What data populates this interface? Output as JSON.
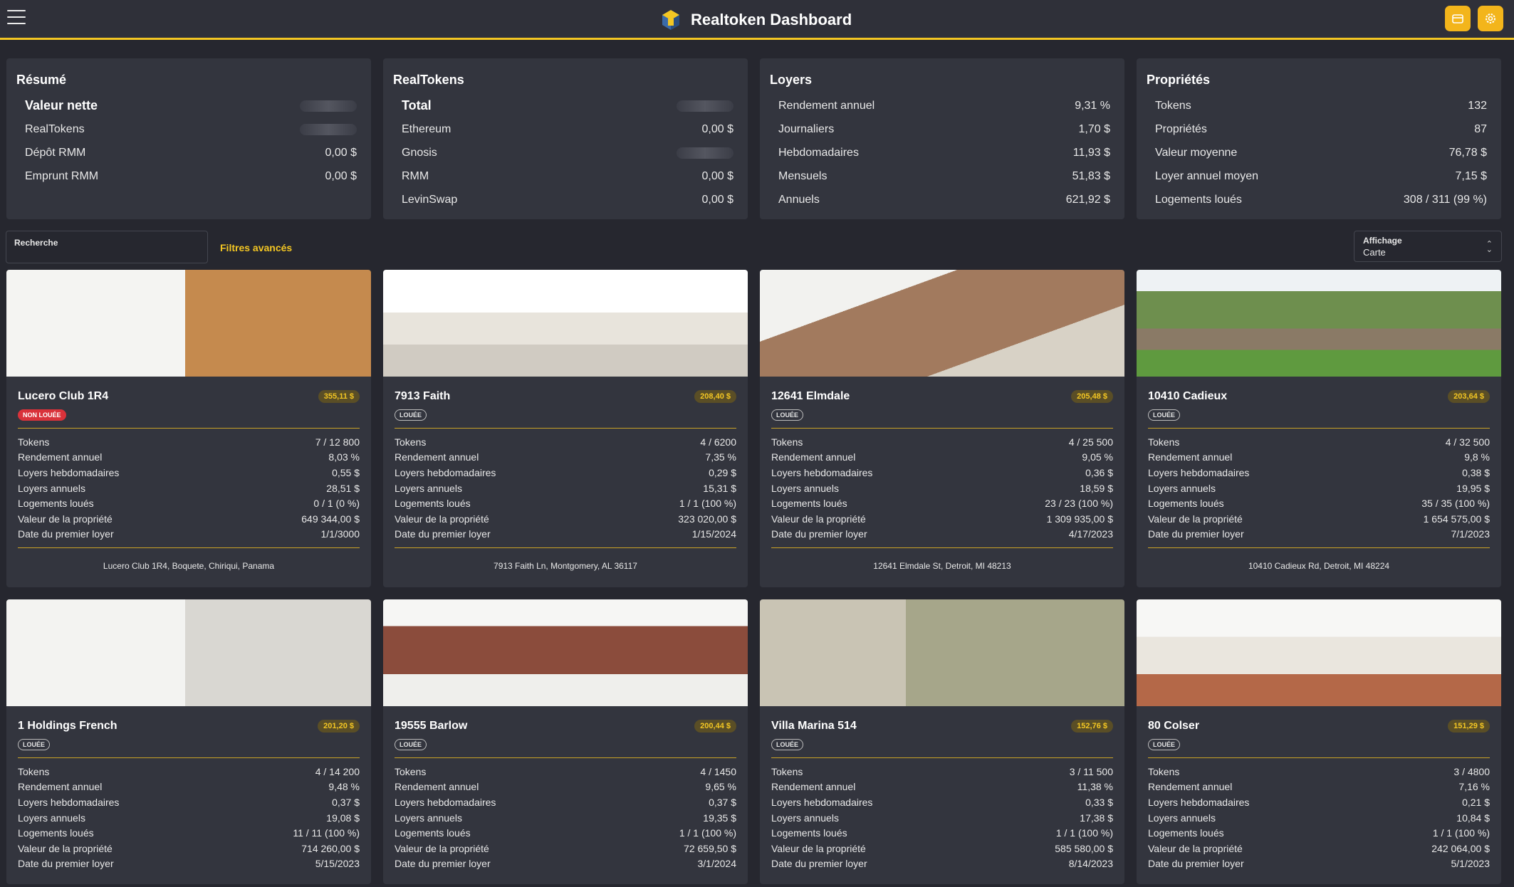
{
  "header": {
    "title": "Realtoken Dashboard",
    "menu_icon": "menu-icon",
    "wallet_icon": "wallet-icon",
    "settings_icon": "gear-icon"
  },
  "summary_cards": [
    {
      "title": "Résumé",
      "rows": [
        {
          "label": "Valeur nette",
          "value": "",
          "blurred": true
        },
        {
          "label": "RealTokens",
          "value": "",
          "blurred": true
        },
        {
          "label": "Dépôt RMM",
          "value": "0,00 $"
        },
        {
          "label": "Emprunt RMM",
          "value": "0,00 $"
        }
      ]
    },
    {
      "title": "RealTokens",
      "rows": [
        {
          "label": "Total",
          "value": "",
          "blurred": true
        },
        {
          "label": "Ethereum",
          "value": "0,00 $"
        },
        {
          "label": "Gnosis",
          "value": "",
          "blurred": true
        },
        {
          "label": "RMM",
          "value": "0,00 $"
        },
        {
          "label": "LevinSwap",
          "value": "0,00 $"
        }
      ]
    },
    {
      "title": "Loyers",
      "rows": [
        {
          "label": "Rendement annuel",
          "value": "9,31 %"
        },
        {
          "label": "Journaliers",
          "value": "1,70 $"
        },
        {
          "label": "Hebdomadaires",
          "value": "11,93 $"
        },
        {
          "label": "Mensuels",
          "value": "51,83 $"
        },
        {
          "label": "Annuels",
          "value": "621,92 $"
        }
      ]
    },
    {
      "title": "Propriétés",
      "rows": [
        {
          "label": "Tokens",
          "value": "132"
        },
        {
          "label": "Propriétés",
          "value": "87"
        },
        {
          "label": "Valeur moyenne",
          "value": "76,78 $"
        },
        {
          "label": "Loyer annuel moyen",
          "value": "7,15 $"
        },
        {
          "label": "Logements loués",
          "value": "308 / 311 (99 %)"
        }
      ]
    }
  ],
  "search": {
    "label": "Recherche"
  },
  "filters": {
    "label": "Filtres avancés"
  },
  "display": {
    "label": "Affichage",
    "value": "Carte"
  },
  "row_labels": [
    "Tokens",
    "Rendement annuel",
    "Loyers hebdomadaires",
    "Loyers annuels",
    "Logements loués",
    "Valeur de la propriété",
    "Date du premier loyer"
  ],
  "properties": [
    {
      "name": "Lucero Club 1R4",
      "price": "355,11 $",
      "status": "NON LOUÉE",
      "rented": false,
      "values": [
        "7 / 12 800",
        "8,03 %",
        "0,55 $",
        "28,51 $",
        "0 / 1 (0 %)",
        "649 344,00 $",
        "1/1/3000"
      ],
      "address": "Lucero Club 1R4, Boquete, Chiriqui, Panama"
    },
    {
      "name": "7913 Faith",
      "price": "208,40 $",
      "status": "LOUÉE",
      "rented": true,
      "values": [
        "4 / 6200",
        "7,35 %",
        "0,29 $",
        "15,31 $",
        "1 / 1 (100 %)",
        "323 020,00 $",
        "1/15/2024"
      ],
      "address": "7913 Faith Ln, Montgomery, AL 36117"
    },
    {
      "name": "12641 Elmdale",
      "price": "205,48 $",
      "status": "LOUÉE",
      "rented": true,
      "values": [
        "4 / 25 500",
        "9,05 %",
        "0,36 $",
        "18,59 $",
        "23 / 23 (100 %)",
        "1 309 935,00 $",
        "4/17/2023"
      ],
      "address": "12641 Elmdale St, Detroit, MI 48213"
    },
    {
      "name": "10410 Cadieux",
      "price": "203,64 $",
      "status": "LOUÉE",
      "rented": true,
      "values": [
        "4 / 32 500",
        "9,8 %",
        "0,38 $",
        "19,95 $",
        "35 / 35 (100 %)",
        "1 654 575,00 $",
        "7/1/2023"
      ],
      "address": "10410 Cadieux Rd, Detroit, MI 48224"
    },
    {
      "name": "1 Holdings French",
      "price": "201,20 $",
      "status": "LOUÉE",
      "rented": true,
      "values": [
        "4 / 14 200",
        "9,48 %",
        "0,37 $",
        "19,08 $",
        "11 / 11 (100 %)",
        "714 260,00 $",
        "5/15/2023"
      ]
    },
    {
      "name": "19555 Barlow",
      "price": "200,44 $",
      "status": "LOUÉE",
      "rented": true,
      "values": [
        "4 / 1450",
        "9,65 %",
        "0,37 $",
        "19,35 $",
        "1 / 1 (100 %)",
        "72 659,50 $",
        "3/1/2024"
      ]
    },
    {
      "name": "Villa Marina 514",
      "price": "152,76 $",
      "status": "LOUÉE",
      "rented": true,
      "values": [
        "3 / 11 500",
        "11,38 %",
        "0,33 $",
        "17,38 $",
        "1 / 1 (100 %)",
        "585 580,00 $",
        "8/14/2023"
      ]
    },
    {
      "name": "80 Colser",
      "price": "151,29 $",
      "status": "LOUÉE",
      "rented": true,
      "values": [
        "3 / 4800",
        "7,16 %",
        "0,21 $",
        "10,84 $",
        "1 / 1 (100 %)",
        "242 064,00 $",
        "5/1/2023"
      ]
    }
  ],
  "colors": {
    "accent": "#f3c623",
    "background": "#26272f",
    "card": "#33353e",
    "badge_red": "#d9323a"
  }
}
